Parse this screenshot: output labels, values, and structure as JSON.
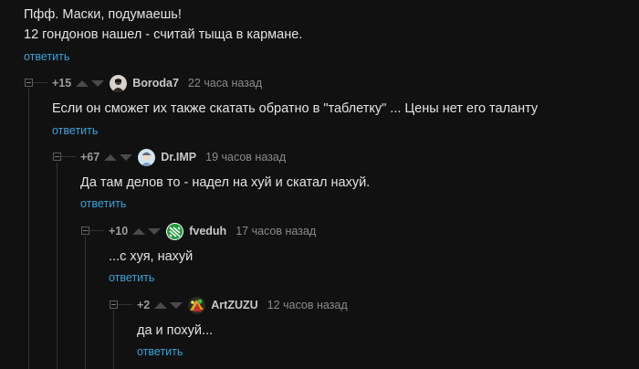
{
  "parent": {
    "lines": [
      "Пфф. Маски, подумаешь!",
      "12 гондонов нашел - считай тыща в кармане."
    ],
    "reply_label": "ответить"
  },
  "comments": [
    {
      "rating": "+15",
      "author": "Boroda7",
      "time": "22 часа назад",
      "text": "Если он сможет их также скатать обратно в \"таблетку\" ... Цены нет его таланту",
      "reply_label": "ответить",
      "avatar_icon": "user-photo-icon"
    },
    {
      "rating": "+67",
      "author": "Dr.IMP",
      "time": "19 часов назад",
      "text": "Да там делов то - надел на хуй и скатал нахуй.",
      "reply_label": "ответить",
      "avatar_icon": "cartoon-avatar-icon"
    },
    {
      "rating": "+10",
      "author": "fveduh",
      "time": "17 часов назад",
      "text": "...с хуя, нахуй",
      "reply_label": "ответить",
      "avatar_icon": "green-logo-avatar-icon"
    },
    {
      "rating": "+2",
      "author": "ArtZUZU",
      "time": "12 часов назад",
      "text": "да и похуй...",
      "reply_label": "ответить",
      "avatar_icon": "colorful-avatar-icon"
    }
  ],
  "colors": {
    "background": "#111111",
    "text": "#e3e3e3",
    "link": "#3aa3d8",
    "meta": "#8a8a8a"
  }
}
